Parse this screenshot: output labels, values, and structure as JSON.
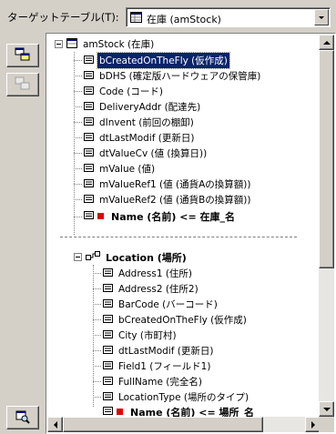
{
  "header": {
    "target_label": "ターゲットテーブル(T):",
    "target_value": "在庫 (amStock)"
  },
  "tree": {
    "root_label": "amStock (在庫)",
    "fields": [
      "bCreatedOnTheFly (仮作成)",
      "bDHS (確定版ハードウェアの保管庫)",
      "Code (コード)",
      "DeliveryAddr (配達先)",
      "dInvent (前回の棚卸)",
      "dtLastModif (更新日)",
      "dtValueCv (値 (換算日))",
      "mValue (値)",
      "mValueRef1 (値 (通貨Aの換算額))",
      "mValueRef2 (値 (通貨Bの換算額))"
    ],
    "name_mapping": "Name (名前)  <=  在庫_名",
    "link_label": "Location (場所)",
    "link_fields": [
      "Address1 (住所)",
      "Address2 (住所2)",
      "BarCode (バーコード)",
      "bCreatedOnTheFly (仮作成)",
      "City (市町村)",
      "dtLastModif (更新日)",
      "Field1 (フィールド1)",
      "FullName (完全名)",
      "LocationType (場所のタイプ)"
    ],
    "link_name_mapping": "Name (名前)  <=  場所_名"
  },
  "colors": {
    "window_bg": "#d4d0c8",
    "selection_bg": "#0a246a",
    "key_marker": "#e00000"
  }
}
